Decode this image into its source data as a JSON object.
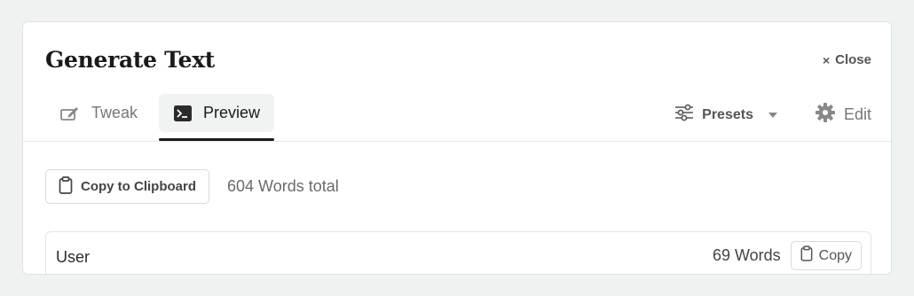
{
  "header": {
    "title": "Generate Text",
    "close_label": "Close",
    "close_glyph": "×"
  },
  "tabs": [
    {
      "label": "Tweak",
      "icon": "pencil-square-icon",
      "active": false
    },
    {
      "label": "Preview",
      "icon": "terminal-icon",
      "active": true
    }
  ],
  "toolbar": {
    "presets_label": "Presets",
    "presets_icon": "sliders-icon",
    "edit_label": "Edit",
    "edit_icon": "gear-icon"
  },
  "actions": {
    "copy_clipboard_label": "Copy to Clipboard",
    "copy_clipboard_icon": "clipboard-icon",
    "words_total": "604 Words total"
  },
  "messages": [
    {
      "role": "User",
      "words": "69 Words",
      "copy_label": "Copy"
    }
  ],
  "colors": {
    "background": "#eef2f1",
    "panel": "#ffffff",
    "active_tab_bg": "#f1f3f2",
    "active_underline": "#1a1a1a"
  }
}
